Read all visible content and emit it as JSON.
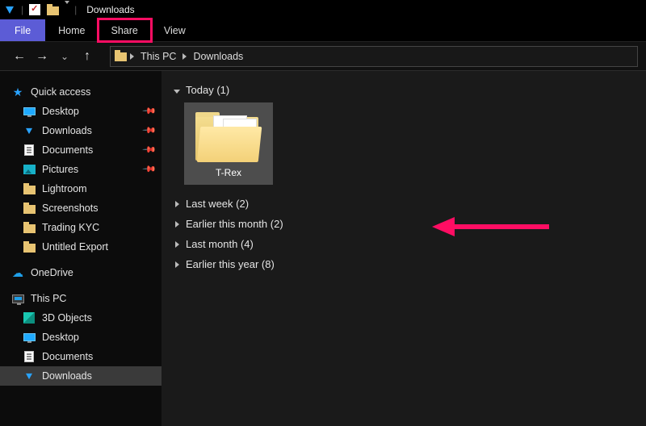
{
  "window": {
    "title": "Downloads"
  },
  "ribbon": {
    "file": "File",
    "tabs": [
      "Home",
      "Share",
      "View"
    ],
    "highlighted_index": 1
  },
  "nav": {
    "back": "Back",
    "forward": "Forward",
    "recent": "Recent locations",
    "up": "Up"
  },
  "address": {
    "crumbs": [
      "This PC",
      "Downloads"
    ]
  },
  "sidebar": {
    "quick_access": "Quick access",
    "quick_items": [
      {
        "label": "Desktop",
        "icon": "monitor",
        "pinned": true
      },
      {
        "label": "Downloads",
        "icon": "download",
        "pinned": true
      },
      {
        "label": "Documents",
        "icon": "document",
        "pinned": true
      },
      {
        "label": "Pictures",
        "icon": "pictures",
        "pinned": true
      },
      {
        "label": "Lightroom",
        "icon": "folder",
        "pinned": false
      },
      {
        "label": "Screenshots",
        "icon": "folder",
        "pinned": false
      },
      {
        "label": "Trading KYC",
        "icon": "folder",
        "pinned": false
      },
      {
        "label": "Untitled Export",
        "icon": "folder",
        "pinned": false
      }
    ],
    "onedrive": "OneDrive",
    "this_pc": "This PC",
    "pc_items": [
      {
        "label": "3D Objects",
        "icon": "cube"
      },
      {
        "label": "Desktop",
        "icon": "monitor"
      },
      {
        "label": "Documents",
        "icon": "document"
      },
      {
        "label": "Downloads",
        "icon": "download",
        "selected": true
      }
    ]
  },
  "content": {
    "groups": [
      {
        "label": "Today",
        "count": 1,
        "expanded": true,
        "items": [
          {
            "name": "T-Rex"
          }
        ]
      },
      {
        "label": "Last week",
        "count": 2,
        "expanded": false
      },
      {
        "label": "Earlier this month",
        "count": 2,
        "expanded": false
      },
      {
        "label": "Last month",
        "count": 4,
        "expanded": false
      },
      {
        "label": "Earlier this year",
        "count": 8,
        "expanded": false
      }
    ]
  },
  "annotation": {
    "arrow_color": "#ff0d63"
  }
}
